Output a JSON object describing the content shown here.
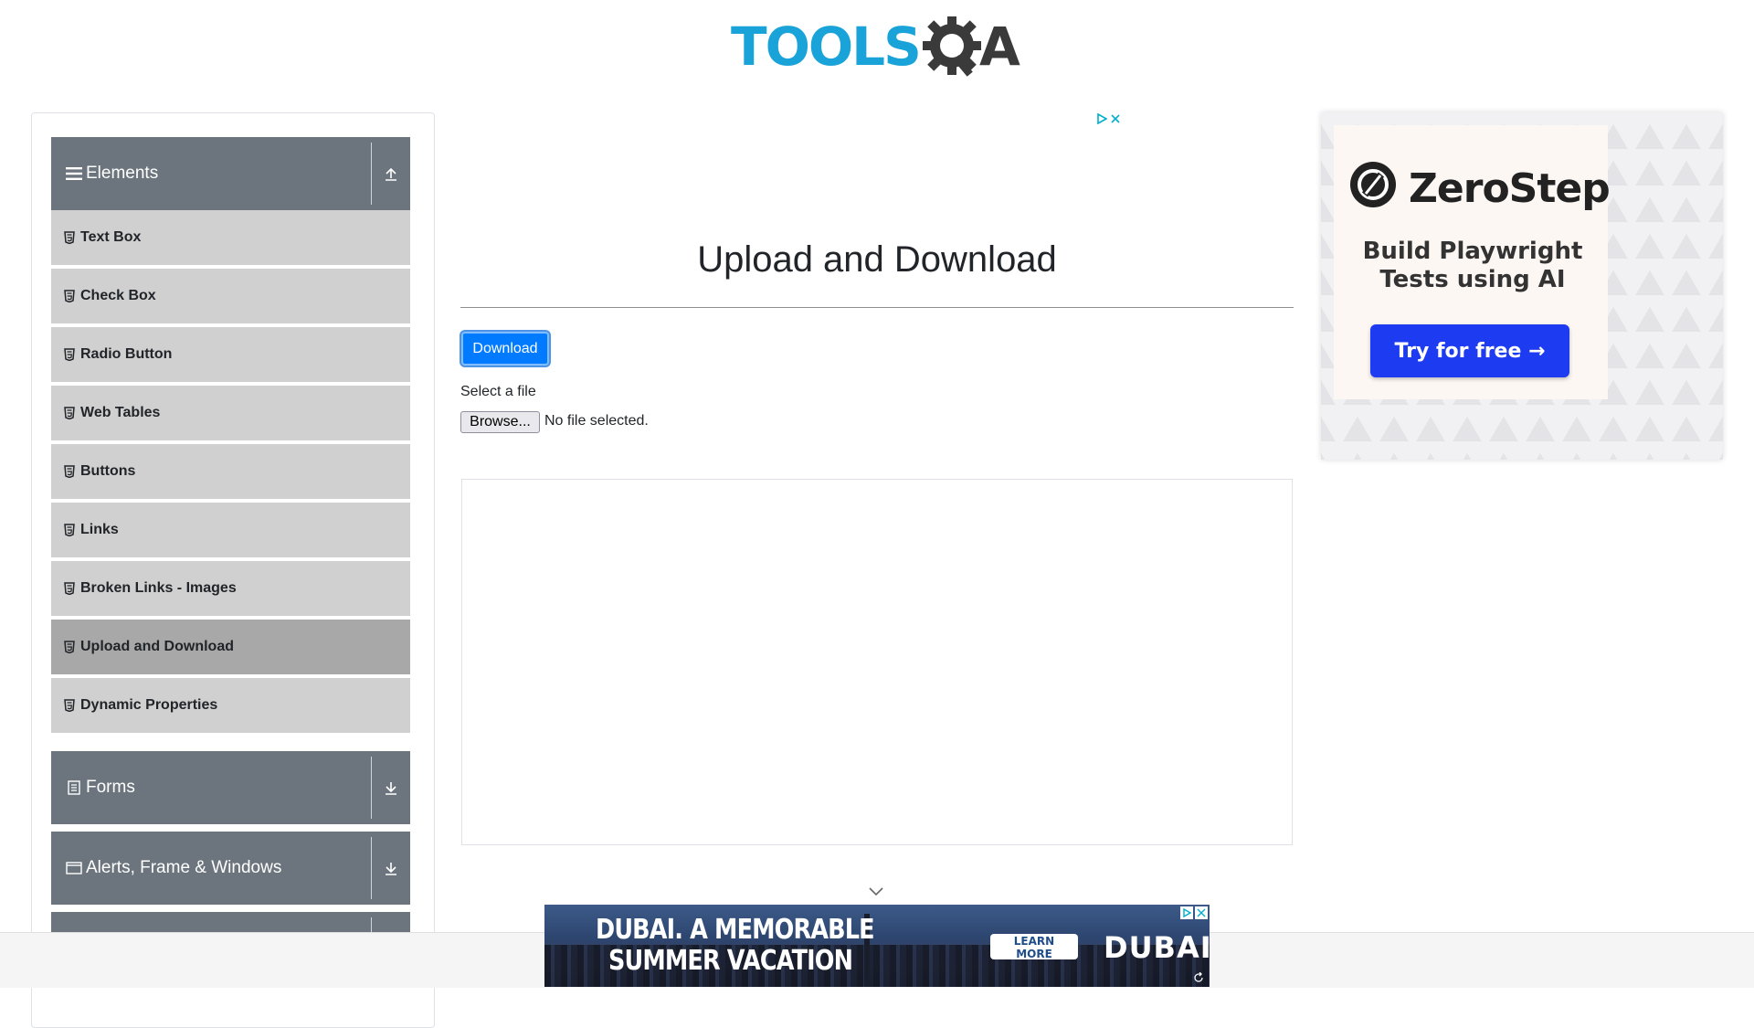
{
  "header": {
    "logo_text_tools": "TOOLS",
    "logo_text_q": "Q",
    "logo_text_a": "A"
  },
  "sidebar": {
    "groups": [
      {
        "label": "Elements",
        "icon": "list-icon",
        "toggle_icon": "collapse-up-icon"
      },
      {
        "label": "Forms",
        "icon": "form-icon",
        "toggle_icon": "expand-down-icon"
      },
      {
        "label": "Alerts, Frame & Windows",
        "icon": "window-icon",
        "toggle_icon": "expand-down-icon"
      }
    ],
    "items": [
      {
        "label": "Text Box"
      },
      {
        "label": "Check Box"
      },
      {
        "label": "Radio Button"
      },
      {
        "label": "Web Tables"
      },
      {
        "label": "Buttons"
      },
      {
        "label": "Links"
      },
      {
        "label": "Broken Links - Images"
      },
      {
        "label": "Upload and Download",
        "active": true
      },
      {
        "label": "Dynamic Properties"
      }
    ]
  },
  "main": {
    "title": "Upload and Download",
    "download_label": "Download",
    "select_label": "Select a file",
    "browse_label": "Browse...",
    "file_status": "No file selected."
  },
  "right_ad": {
    "brand": "ZeroStep",
    "tagline": "Build Playwright Tests using AI",
    "cta": "Try for free →"
  },
  "bottom_ad": {
    "headline_1": "DUBAI. A MEMORABLE",
    "headline_2": "SUMMER VACATION",
    "cta": "LEARN MORE",
    "brand": "DUBAI"
  },
  "colors": {
    "brand_blue": "#1aa3d9",
    "sidebar_header": "#6c757d",
    "menu_item": "#d0d0d0",
    "menu_item_active": "#a8a8a8",
    "primary_button": "#007bff",
    "ad_cta": "#1d3bf0"
  }
}
